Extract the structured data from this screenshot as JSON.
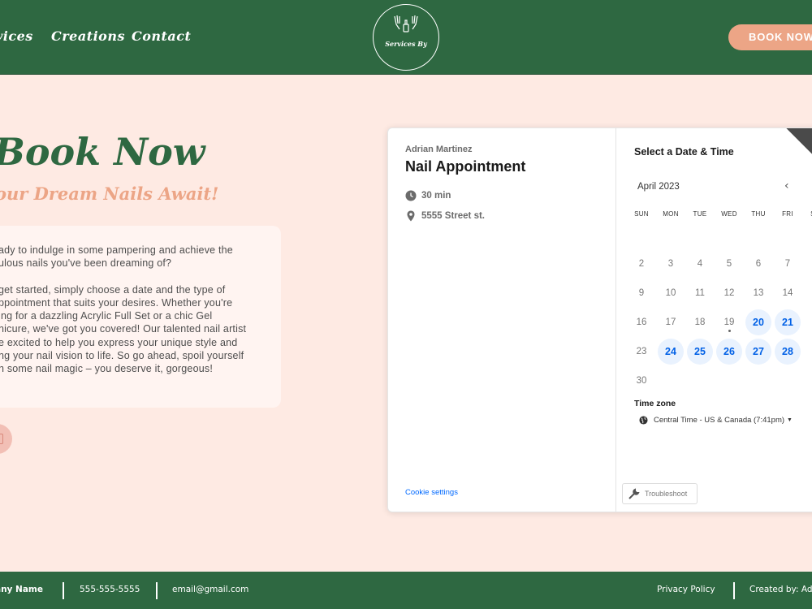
{
  "nav": {
    "items": [
      "vices",
      "Creations",
      "Contact"
    ],
    "logo_text": "Services By",
    "book_button": "BOOK NOW"
  },
  "hero": {
    "title": "Book Now",
    "subtitle": "our Dream Nails Await!",
    "paragraph1": "ady to indulge in some pampering and achieve the ulous nails you've been dreaming of?",
    "paragraph2_lines": [
      "get started, simply choose a date and the type of",
      "ppointment that suits your desires. Whether you're",
      "ing for a dazzling Acrylic Full Set or a chic Gel",
      "nicure, we've got you covered! Our talented nail artist",
      "e excited to help you express your unique style and",
      "ng your nail vision to life. So go ahead, spoil yourself",
      "h some nail magic – you deserve it, gorgeous!"
    ],
    "paragraph1_lines": [
      "ady to indulge in some pampering and achieve the",
      "ulous nails you've been dreaming of?"
    ]
  },
  "widget": {
    "host": "Adrian Martinez",
    "event_title": "Nail Appointment",
    "duration": "30 min",
    "location": "5555 Street st.",
    "cookie_settings": "Cookie settings",
    "select_title": "Select a Date & Time",
    "month": "April 2023",
    "days_of_week": [
      "SUN",
      "MON",
      "TUE",
      "WED",
      "THU",
      "FRI",
      "SAT"
    ],
    "days": [
      {
        "d": "2",
        "avail": false
      },
      {
        "d": "3",
        "avail": false
      },
      {
        "d": "4",
        "avail": false
      },
      {
        "d": "5",
        "avail": false
      },
      {
        "d": "6",
        "avail": false
      },
      {
        "d": "7",
        "avail": false
      },
      {
        "d": "9",
        "avail": false
      },
      {
        "d": "10",
        "avail": false
      },
      {
        "d": "11",
        "avail": false
      },
      {
        "d": "12",
        "avail": false
      },
      {
        "d": "13",
        "avail": false
      },
      {
        "d": "14",
        "avail": false
      },
      {
        "d": "16",
        "avail": false
      },
      {
        "d": "17",
        "avail": false
      },
      {
        "d": "18",
        "avail": false
      },
      {
        "d": "19",
        "avail": false,
        "today": true
      },
      {
        "d": "20",
        "avail": true
      },
      {
        "d": "21",
        "avail": true
      },
      {
        "d": "23",
        "avail": false
      },
      {
        "d": "24",
        "avail": true
      },
      {
        "d": "25",
        "avail": true
      },
      {
        "d": "26",
        "avail": true
      },
      {
        "d": "27",
        "avail": true
      },
      {
        "d": "28",
        "avail": true
      },
      {
        "d": "30",
        "avail": false
      }
    ],
    "timezone_label": "Time zone",
    "timezone_value": "Central Time - US & Canada (7:41pm)",
    "troubleshoot": "Troubleshoot"
  },
  "footer": {
    "company": "any Name",
    "phone": "555-555-5555",
    "email": "email@gmail.com",
    "privacy": "Privacy Policy",
    "created_by": "Created by: Adri"
  },
  "colors": {
    "primary_green": "#2e6841",
    "accent_peach": "#eca586",
    "background": "#feeae3",
    "calendar_blue": "#0060e6"
  }
}
